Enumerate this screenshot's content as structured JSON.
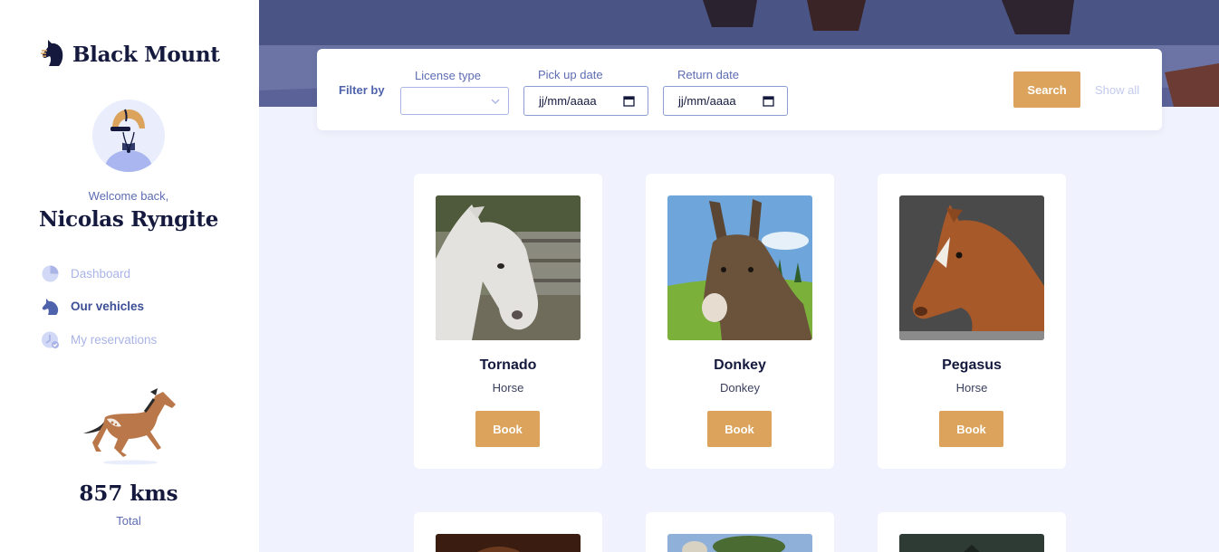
{
  "brand": {
    "name": "Black Mount"
  },
  "user": {
    "welcome": "Welcome back,",
    "name": "Nicolas Ryngite"
  },
  "nav": [
    {
      "label": "Dashboard",
      "icon": "pie-chart-icon",
      "active": false
    },
    {
      "label": "Our vehicles",
      "icon": "horse-head-icon",
      "active": true
    },
    {
      "label": "My reservations",
      "icon": "clock-check-icon",
      "active": false
    }
  ],
  "stats": {
    "value": "857 kms",
    "label": "Total"
  },
  "filter": {
    "label": "Filter by",
    "license_label": "License type",
    "license_value": "",
    "pickup_label": "Pick up date",
    "pickup_value": "jj/mm/aaaa",
    "return_label": "Return date",
    "return_value": "jj/mm/aaaa",
    "search_label": "Search",
    "show_all_label": "Show all"
  },
  "vehicles": [
    {
      "name": "Tornado",
      "type": "Horse",
      "book_label": "Book"
    },
    {
      "name": "Donkey",
      "type": "Donkey",
      "book_label": "Book"
    },
    {
      "name": "Pegasus",
      "type": "Horse",
      "book_label": "Book"
    }
  ],
  "colors": {
    "accent": "#dba35c",
    "navy": "#14193d",
    "primary": "#4f63ad",
    "muted": "#aab4e6",
    "background": "#f0f2fd"
  }
}
